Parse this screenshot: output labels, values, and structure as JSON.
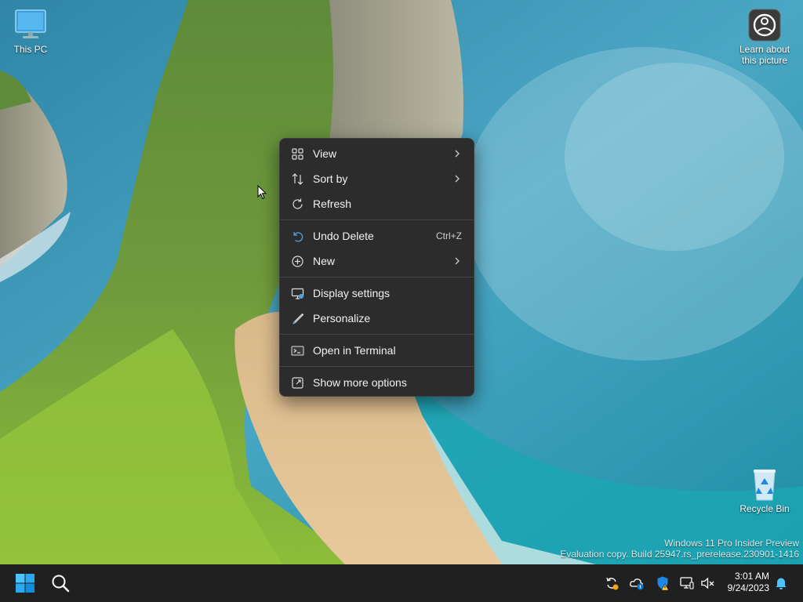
{
  "desktop": {
    "this_pc_label": "This PC",
    "learn_label_line1": "Learn about",
    "learn_label_line2": "this picture",
    "recycle_bin_label": "Recycle Bin"
  },
  "context_menu": {
    "items": [
      {
        "label": "View",
        "icon": "grid-icon",
        "submenu": true
      },
      {
        "label": "Sort by",
        "icon": "sort-icon",
        "submenu": true
      },
      {
        "label": "Refresh",
        "icon": "refresh-icon",
        "submenu": false
      },
      {
        "label": "Undo Delete",
        "icon": "undo-icon",
        "shortcut": "Ctrl+Z"
      },
      {
        "label": "New",
        "icon": "plus-circle-icon",
        "submenu": true
      },
      {
        "label": "Display settings",
        "icon": "display-icon"
      },
      {
        "label": "Personalize",
        "icon": "brush-icon"
      },
      {
        "label": "Open in Terminal",
        "icon": "terminal-icon"
      },
      {
        "label": "Show more options",
        "icon": "expand-icon"
      }
    ]
  },
  "watermark": {
    "line1": "Windows 11 Pro Insider Preview",
    "line2": "Evaluation copy. Build 25947.rs_prerelease.230901-1416"
  },
  "taskbar": {
    "time": "3:01 AM",
    "date": "9/24/2023"
  },
  "colors": {
    "accent": "#0078d4",
    "menu_bg": "#2c2c2c",
    "taskbar_bg": "#202020"
  }
}
